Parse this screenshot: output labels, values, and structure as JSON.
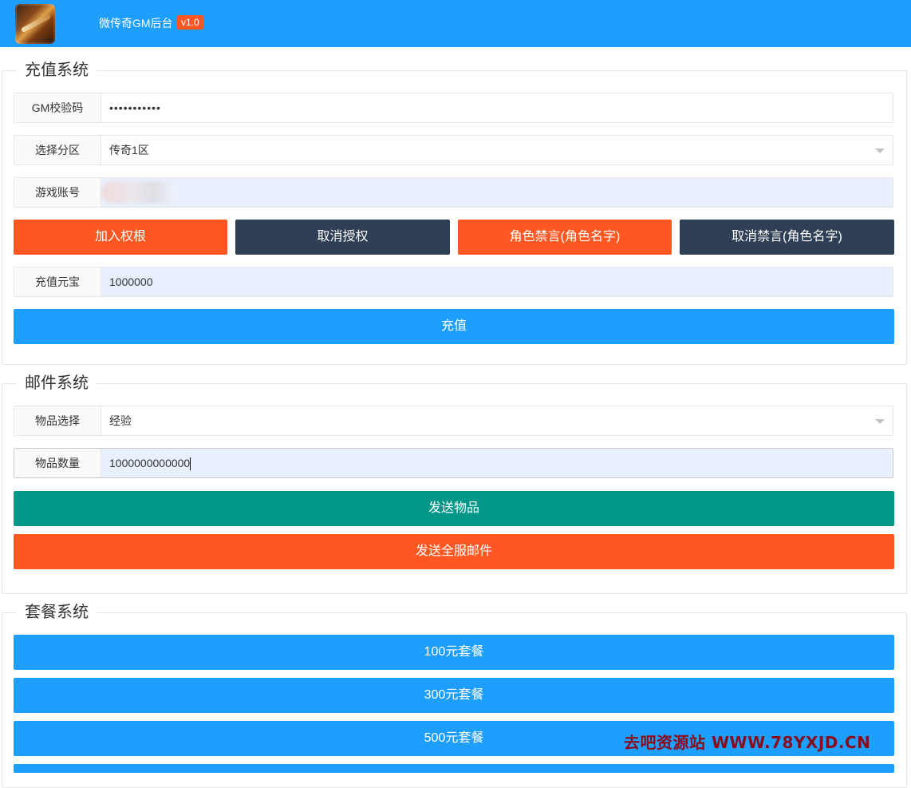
{
  "header": {
    "logo_icon": "game-logo-icon",
    "title": "微传奇GM后台",
    "version": "v1.0",
    "background": "#1E9FFF"
  },
  "recharge": {
    "legend": "充值系统",
    "gm_code": {
      "label": "GM校验码",
      "value": "•••••••••••"
    },
    "server": {
      "label": "选择分区",
      "value": "传奇1区"
    },
    "account": {
      "label": "游戏账号",
      "value": ""
    },
    "buttons": {
      "grant": "加入权根",
      "revoke": "取消授权",
      "mute": "角色禁言(角色名字)",
      "unmute": "取消禁言(角色名字)"
    },
    "amount": {
      "label": "充值元宝",
      "value": "1000000"
    },
    "submit": "充值"
  },
  "mail": {
    "legend": "邮件系统",
    "item": {
      "label": "物品选择",
      "value": "经验"
    },
    "quantity": {
      "label": "物品数量",
      "value": "1000000000000"
    },
    "send": "发送物品",
    "send_all": "发送全服邮件"
  },
  "package": {
    "legend": "套餐系统",
    "items": [
      "100元套餐",
      "300元套餐",
      "500元套餐"
    ]
  },
  "watermark": "去吧资源站 WWW.78YXJD.CN",
  "colors": {
    "primary": "#1E9FFF",
    "orange": "#FF5722",
    "dark": "#2F4056",
    "green": "#009688"
  }
}
